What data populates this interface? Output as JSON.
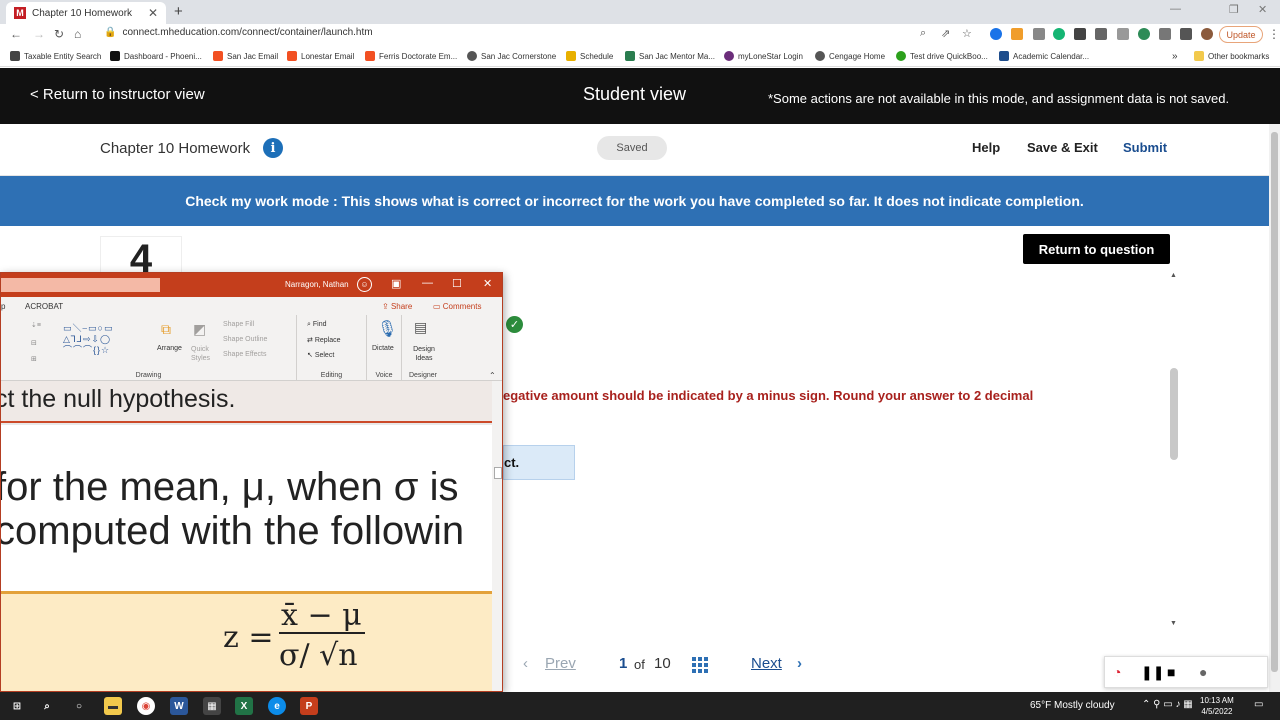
{
  "browser": {
    "tab_title": "Chapter 10 Homework",
    "tab_favicon": "M",
    "url": "connect.mheducation.com/connect/container/launch.htm",
    "update_label": "Update",
    "bookmarks": [
      "Taxable Entity Search",
      "Dashboard - Phoeni...",
      "San Jac Email",
      "Lonestar Email",
      "Ferris Doctorate Em...",
      "San Jac Cornerstone",
      "Schedule",
      "San Jac Mentor Ma...",
      "myLoneStar Login",
      "Cengage Home",
      "Test drive QuickBoo...",
      "Academic Calendar..."
    ],
    "other_bookmarks": "Other bookmarks"
  },
  "studentbar": {
    "return_label": "< Return to instructor view",
    "mode_label": "Student view",
    "note": "*Some actions are not available in this mode, and assignment data is not saved."
  },
  "assignment": {
    "title": "Chapter 10 Homework",
    "info_icon": "i",
    "saved_label": "Saved",
    "help_label": "Help",
    "save_exit_label": "Save & Exit",
    "submit_label": "Submit"
  },
  "banner": {
    "text": "Check my work mode : This shows what is correct or incorrect for the work you have completed so far. It does not indicate completion."
  },
  "question": {
    "number": "4",
    "return_label": "Return to question",
    "instruction_fragment": "egative amount should be indicated by a minus sign. Round your answer to 2 decimal",
    "answer_fragment": "ct."
  },
  "pager": {
    "prev_label": "Prev",
    "current": "1",
    "of_label": "of",
    "total": "10",
    "next_label": "Next"
  },
  "ppt": {
    "user_name": "Narragon, Nathan",
    "tabs": [
      "p",
      "ACROBAT"
    ],
    "share_label": "Share",
    "comments_label": "Comments",
    "ribbon": {
      "arrange": "Arrange",
      "quick_styles": "Quick Styles",
      "shape_fill": "Shape Fill",
      "shape_outline": "Shape Outline",
      "shape_effects": "Shape Effects",
      "find": "Find",
      "replace": "Replace",
      "select": "Select",
      "dictate": "Dictate",
      "design_ideas": "Design Ideas",
      "group_drawing": "Drawing",
      "group_editing": "Editing",
      "group_voice": "Voice",
      "group_designer": "Designer"
    },
    "slide": {
      "heading": "ct the null hypothesis.",
      "line1": "for the mean, μ, when σ is",
      "line2": "computed with the followin",
      "formula_lhs": "z =",
      "formula_num": "x̄ − μ",
      "formula_den": "σ/ √n"
    }
  },
  "taskbar": {
    "weather": "65°F  Mostly cloudy",
    "time": "10:13 AM",
    "date": "4/5/2022"
  }
}
